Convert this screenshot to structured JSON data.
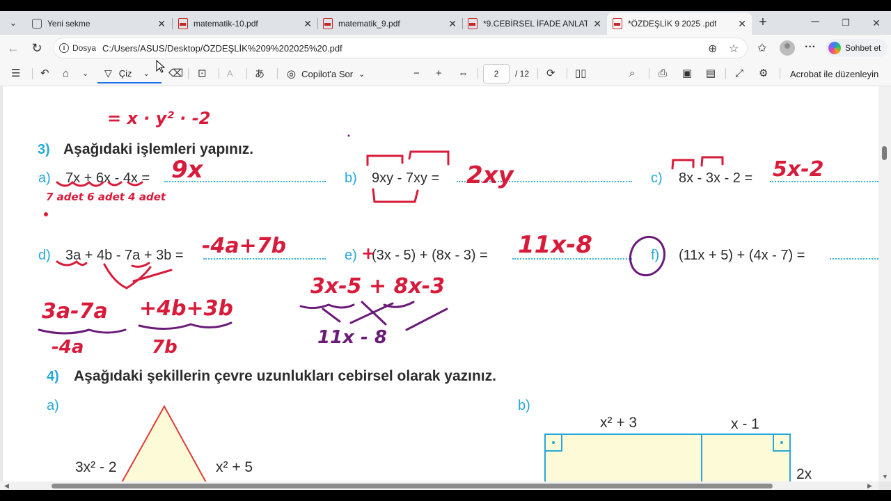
{
  "tabs": [
    {
      "label": "Yeni sekme",
      "icon": "new-tab-icon",
      "active": false
    },
    {
      "label": "matematik-10.pdf",
      "icon": "pdf-icon",
      "active": false
    },
    {
      "label": "matematik_9.pdf",
      "icon": "pdf-icon",
      "active": false
    },
    {
      "label": "*9.CEBİRSEL İFADE ANLATIM.p",
      "icon": "pdf-icon",
      "active": false
    },
    {
      "label": "*ÖZDEŞLİK 9 2025 .pdf",
      "icon": "pdf-icon",
      "active": true
    }
  ],
  "address": {
    "site_label": "Dosya",
    "url": "C:/Users/ASUS/Desktop/ÖZDEŞLİK%209%202025%20.pdf",
    "chat_label": "Sohbet et"
  },
  "toolbar": {
    "draw_label": "Çiz",
    "copilot_label": "Copilot'a Sor",
    "page_current": "2",
    "page_total": "/ 12",
    "acrobat_label": "Acrobat ile düzenleyin"
  },
  "document": {
    "q3": {
      "number": "3)",
      "title": "Aşağıdaki işlemleri yapınız.",
      "items": [
        {
          "letter": "a)",
          "expr": "7x + 6x - 4x ="
        },
        {
          "letter": "b)",
          "expr": "9xy - 7xy ="
        },
        {
          "letter": "c)",
          "expr": "8x - 3x - 2 ="
        },
        {
          "letter": "d)",
          "expr": "3a + 4b - 7a + 3b ="
        },
        {
          "letter": "e)",
          "expr": "(3x - 5) + (8x - 3) ="
        },
        {
          "letter": "f)",
          "expr": "(11x + 5) + (4x - 7) ="
        }
      ]
    },
    "q4": {
      "number": "4)",
      "title": "Aşağıdaki şekillerin çevre uzunlukları cebirsel olarak yazınız.",
      "a_letter": "a)",
      "b_letter": "b)",
      "triangle_left": "3x² - 2",
      "triangle_right": "x² + 5",
      "rect_top_left": "x² + 3",
      "rect_top_right": "x - 1",
      "rect_side": "2x"
    },
    "handwriting": {
      "top_line": "= x · y² · -2",
      "answer_a": "9x",
      "note_a": "7 adet 6 adet 4 adet",
      "answer_b": "2xy",
      "answer_c": "5x-2",
      "answer_d": "-4a+7b",
      "work_d_1": "3a-7a",
      "work_d_2": "+4b+3b",
      "work_d_3": "-4a",
      "work_d_4": "7b",
      "answer_e": "11x-8",
      "work_e_1": "3x-5 + 8x-3",
      "work_e_2": "11x - 8"
    }
  }
}
